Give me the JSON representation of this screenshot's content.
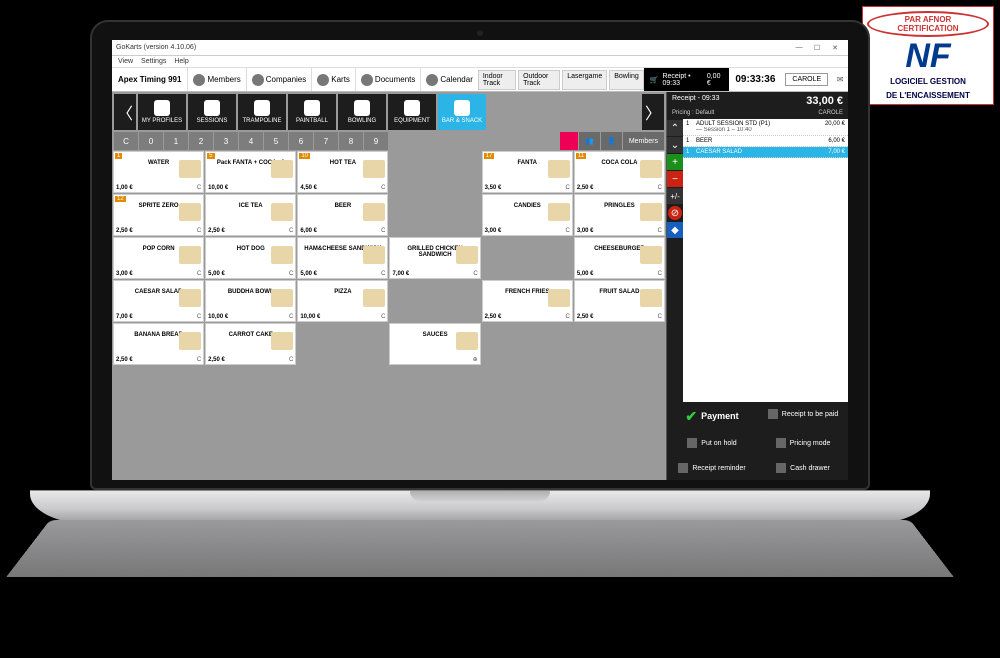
{
  "window": {
    "title": "GoKarts (version 4.10.06)",
    "menus": [
      "View",
      "Settings",
      "Help"
    ]
  },
  "toolbar": {
    "location": "Apex Timing 991",
    "items": [
      "Members",
      "Companies",
      "Karts",
      "Documents",
      "Calendar"
    ],
    "tracks": [
      "Indoor Track",
      "Outdoor Track",
      "Lasergame",
      "Bowling"
    ],
    "receipt_label": "Receipt • 09:33",
    "receipt_amount": "0,00 €",
    "time": "09:33:36",
    "user": "CAROLE"
  },
  "categories": {
    "items": [
      "MY PROFILES",
      "SESSIONS",
      "TRAMPOLINE",
      "PAINTBALL",
      "BOWLING",
      "EQUIPMENT",
      "BAR & SNACK"
    ],
    "selected": 6
  },
  "numbers": [
    "C",
    "0",
    "1",
    "2",
    "3",
    "4",
    "5",
    "6",
    "7",
    "8",
    "9"
  ],
  "members_label": "Members",
  "products": [
    {
      "tag": "1",
      "name": "WATER",
      "price": "1,00 €",
      "kb": "C"
    },
    {
      "tag": "5",
      "name": "Pack FANTA + COCA x3",
      "price": "10,00 €",
      "kb": ""
    },
    {
      "tag": "10",
      "name": "HOT TEA",
      "price": "4,50 €",
      "kb": "C"
    },
    {
      "tag": "17",
      "name": "FANTA",
      "price": "3,50 €",
      "kb": "C"
    },
    {
      "tag": "11",
      "name": "COCA COLA",
      "price": "2,50 €",
      "kb": "C"
    },
    {
      "tag": "12",
      "name": "SPRITE ZERO",
      "price": "2,50 €",
      "kb": "C"
    },
    {
      "tag": "",
      "name": "ICE TEA",
      "price": "2,50 €",
      "kb": "C"
    },
    {
      "tag": "",
      "name": "BEER",
      "price": "6,00 €",
      "kb": "C"
    },
    {
      "tag": "",
      "name": "CANDIES",
      "price": "3,00 €",
      "kb": "C"
    },
    {
      "tag": "",
      "name": "PRINGLES",
      "price": "3,00 €",
      "kb": "C"
    },
    {
      "tag": "",
      "name": "POP CORN",
      "price": "3,00 €",
      "kb": "C"
    },
    {
      "tag": "",
      "name": "HOT DOG",
      "price": "5,00 €",
      "kb": "C"
    },
    {
      "tag": "",
      "name": "HAM&CHEESE SANDWICH",
      "price": "5,00 €",
      "kb": "C"
    },
    {
      "tag": "",
      "name": "GRILLED CHICKEN SANDWICH",
      "price": "7,00 €",
      "kb": "C"
    },
    {
      "tag": "",
      "name": "CHEESEBURGER",
      "price": "5,00 €",
      "kb": "C"
    },
    {
      "tag": "",
      "name": "CAESAR SALAD",
      "price": "7,00 €",
      "kb": "C"
    },
    {
      "tag": "",
      "name": "BUDDHA BOWL",
      "price": "10,00 €",
      "kb": "C"
    },
    {
      "tag": "",
      "name": "PIZZA",
      "price": "10,00 €",
      "kb": "C"
    },
    {
      "tag": "",
      "name": "FRENCH FRIES",
      "price": "2,50 €",
      "kb": "C"
    },
    {
      "tag": "",
      "name": "FRUIT SALAD",
      "price": "2,50 €",
      "kb": "C"
    },
    {
      "tag": "",
      "name": "BANANA BREAD",
      "price": "2,50 €",
      "kb": "C"
    },
    {
      "tag": "",
      "name": "CARROT CAKE",
      "price": "2,50 €",
      "kb": "C"
    },
    {
      "tag": "",
      "name": "SAUCES",
      "price": "",
      "kb": "⊕"
    }
  ],
  "receipt": {
    "id": "Receipt - 09:33",
    "pricing": "Pricing : Default",
    "customer": "CAROLE",
    "total": "33,00 €",
    "lines": [
      {
        "qty": "1",
        "name": "ADULT SESSION STD (P1)",
        "sub": "— Session 1 – 10:40",
        "price": "20,00 €",
        "sel": false
      },
      {
        "qty": "1",
        "name": "BEER",
        "sub": "",
        "price": "6,00 €",
        "sel": false
      },
      {
        "qty": "1",
        "name": "CAESAR SALAD",
        "sub": "",
        "price": "7,00 €",
        "sel": true
      }
    ]
  },
  "actions": {
    "payment": "Payment",
    "receipt_to_be_paid": "Receipt to be paid",
    "put_on_hold": "Put on hold",
    "pricing_mode": "Pricing mode",
    "receipt_reminder": "Receipt reminder",
    "cash_drawer": "Cash drawer"
  },
  "nf": {
    "ring": "PAR AFNOR CERTIFICATION",
    "mark": "NF",
    "line1": "LOGICIEL GESTION",
    "line2": "DE L'ENCAISSEMENT"
  }
}
